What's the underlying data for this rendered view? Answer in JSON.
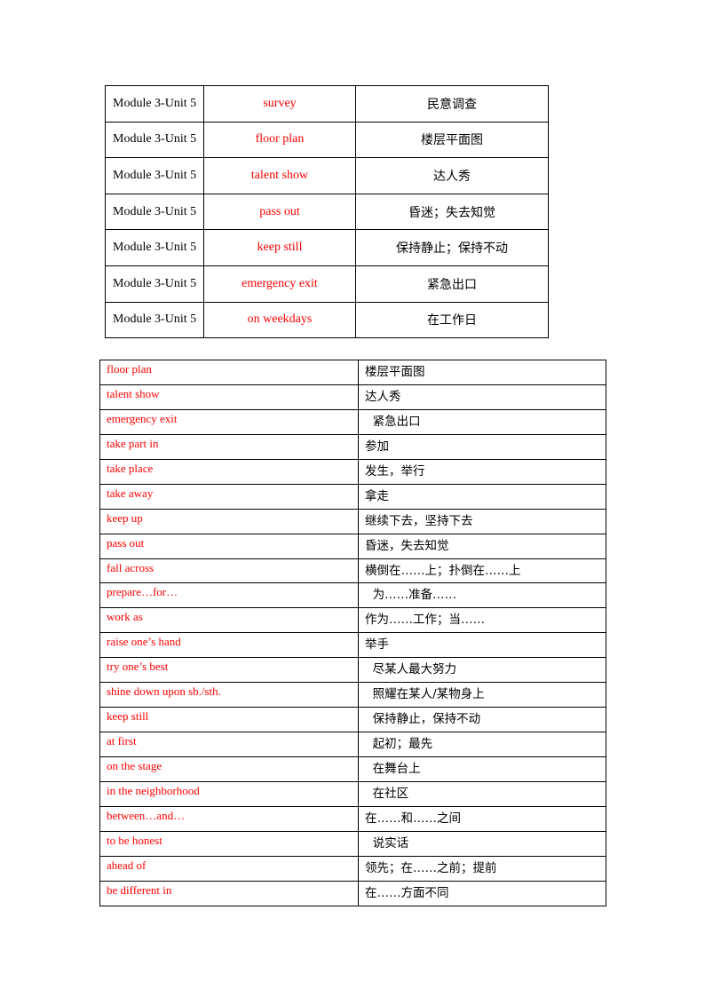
{
  "table1": {
    "rows": [
      {
        "unit": "Module 3-Unit 5",
        "en": "survey",
        "zh": "民意调查"
      },
      {
        "unit": "Module 3-Unit 5",
        "en": "floor plan",
        "zh": "楼层平面图"
      },
      {
        "unit": "Module 3-Unit 5",
        "en": "talent show",
        "zh": "达人秀"
      },
      {
        "unit": "Module 3-Unit 5",
        "en": "pass out",
        "zh": "昏迷；失去知觉"
      },
      {
        "unit": "Module 3-Unit 5",
        "en": "keep still",
        "zh": "保持静止；保持不动"
      },
      {
        "unit": "Module 3-Unit 5",
        "en": "emergency exit",
        "zh": "紧急出口"
      },
      {
        "unit": "Module 3-Unit 5",
        "en": "on weekdays",
        "zh": "在工作日"
      }
    ]
  },
  "table2": {
    "rows": [
      {
        "en": "floor plan",
        "zh": "楼层平面图"
      },
      {
        "en": "talent show",
        "zh": "达人秀"
      },
      {
        "en": "emergency exit",
        "zh": "  紧急出口"
      },
      {
        "en": "take part in",
        "zh": "参加"
      },
      {
        "en": "take place",
        "zh": "发生，举行"
      },
      {
        "en": "take away",
        "zh": "拿走"
      },
      {
        "en": "keep up",
        "zh": "继续下去，坚持下去"
      },
      {
        "en": "pass out",
        "zh": "昏迷，失去知觉"
      },
      {
        "en": "fall across",
        "zh": "横倒在……上；扑倒在……上"
      },
      {
        "en": "prepare…for…",
        "zh": "  为……准备……"
      },
      {
        "en": "work as",
        "zh": "作为……工作；当……"
      },
      {
        "en": "raise one’s hand",
        "zh": "举手"
      },
      {
        "en": "try one’s best",
        "zh": "  尽某人最大努力"
      },
      {
        "en": "shine down upon sb./sth.",
        "zh": "  照耀在某人/某物身上"
      },
      {
        "en": "keep still",
        "zh": "  保持静止，保持不动"
      },
      {
        "en": "at first",
        "zh": "  起初；最先"
      },
      {
        "en": "on the stage",
        "zh": "  在舞台上"
      },
      {
        "en": "in the neighborhood",
        "zh": "  在社区"
      },
      {
        "en": "between…and…",
        "zh": "在……和……之间"
      },
      {
        "en": "to be honest",
        "zh": "  说实话"
      },
      {
        "en": "ahead of",
        "zh": "领先；在……之前；提前"
      },
      {
        "en": "be different in",
        "zh": "在……方面不同"
      }
    ]
  }
}
